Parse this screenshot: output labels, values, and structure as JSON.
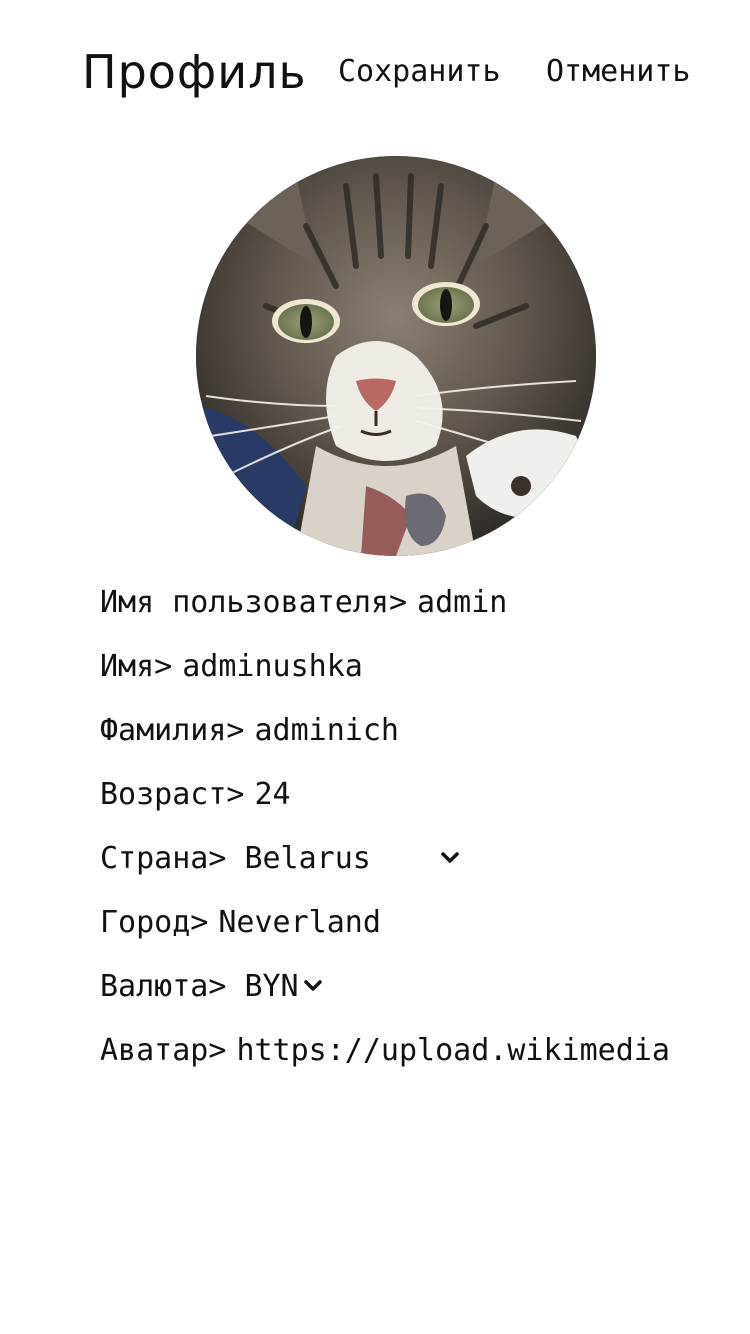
{
  "header": {
    "title": "Профиль",
    "save_label": "Сохранить",
    "cancel_label": "Отменить"
  },
  "avatar": {
    "description_icon": "cat-photo"
  },
  "form": {
    "username": {
      "label": "Имя пользователя>",
      "value": "admin"
    },
    "first_name": {
      "label": "Имя>",
      "value": "adminushka"
    },
    "last_name": {
      "label": "Фамилия>",
      "value": "adminich"
    },
    "age": {
      "label": "Возраст>",
      "value": "24"
    },
    "country": {
      "label": "Страна>",
      "selected": "Belarus"
    },
    "city": {
      "label": "Город>",
      "value": "Neverland"
    },
    "currency": {
      "label": "Валюта>",
      "selected": "BYN"
    },
    "avatar_url": {
      "label": "Аватар>",
      "value": "https://upload.wikimedia"
    }
  }
}
